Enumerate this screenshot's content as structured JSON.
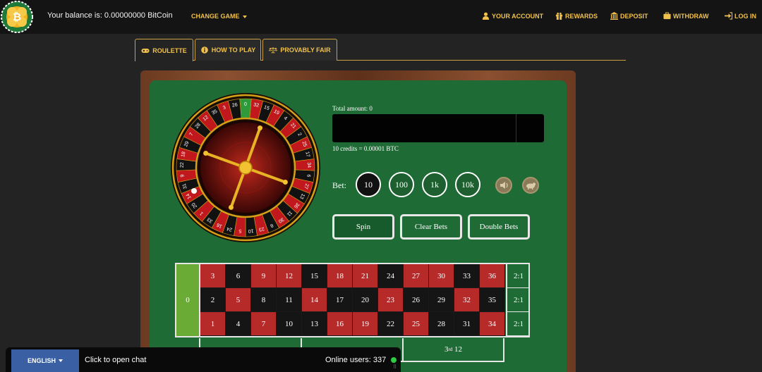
{
  "header": {
    "balance_text": "Your balance is: 0.00000000 BitCoin",
    "change_game_label": "CHANGE GAME",
    "nav": [
      {
        "label": "YOUR ACCOUNT",
        "icon": "user-icon"
      },
      {
        "label": "REWARDS",
        "icon": "gift-icon"
      },
      {
        "label": "DEPOSIT",
        "icon": "bank-icon"
      },
      {
        "label": "WITHDRAW",
        "icon": "briefcase-icon"
      },
      {
        "label": "LOG IN",
        "icon": "login-icon"
      }
    ],
    "accent_color": "#f0c14b"
  },
  "tabs": [
    {
      "label": "ROULETTE",
      "icon": "gamepad-icon",
      "active": true
    },
    {
      "label": "HOW TO PLAY",
      "icon": "info-icon",
      "active": false
    },
    {
      "label": "PROVABLY FAIR",
      "icon": "scale-icon",
      "active": false
    }
  ],
  "game": {
    "total_label": "Total amount: 0",
    "credits_note": "10 credits = 0.00001 BTC",
    "bet_label": "Bet:",
    "chips": [
      "10",
      "100",
      "1k",
      "10k"
    ],
    "selected_chip": "10",
    "buttons": {
      "spin": "Spin",
      "clear": "Clear Bets",
      "double": "Double Bets"
    },
    "wheel_numbers": [
      "0",
      "32",
      "15",
      "19",
      "4",
      "21",
      "2",
      "25",
      "17",
      "34",
      "6",
      "27",
      "13",
      "36",
      "11",
      "30",
      "8",
      "23",
      "10",
      "5",
      "24",
      "16",
      "33",
      "1",
      "20",
      "14",
      "31",
      "9",
      "22",
      "18",
      "29",
      "7",
      "28",
      "12",
      "35",
      "3",
      "26"
    ]
  },
  "board": {
    "zero": "0",
    "rows": [
      [
        "3",
        "6",
        "9",
        "12",
        "15",
        "18",
        "21",
        "24",
        "27",
        "30",
        "33",
        "36"
      ],
      [
        "2",
        "5",
        "8",
        "11",
        "14",
        "17",
        "20",
        "23",
        "26",
        "29",
        "32",
        "35"
      ],
      [
        "1",
        "4",
        "7",
        "10",
        "13",
        "16",
        "19",
        "22",
        "25",
        "28",
        "31",
        "34"
      ]
    ],
    "red_numbers": [
      "1",
      "3",
      "5",
      "7",
      "9",
      "12",
      "14",
      "16",
      "18",
      "19",
      "21",
      "23",
      "25",
      "27",
      "30",
      "32",
      "34",
      "36"
    ],
    "column_label": "2:1",
    "dozen_third": "12",
    "dozen_third_ordinal": "3",
    "dozen_third_suffix": "rd"
  },
  "footer": {
    "language": "ENGLISH",
    "chat_prompt": "Click to open chat",
    "online_users": "Online users: 337"
  }
}
